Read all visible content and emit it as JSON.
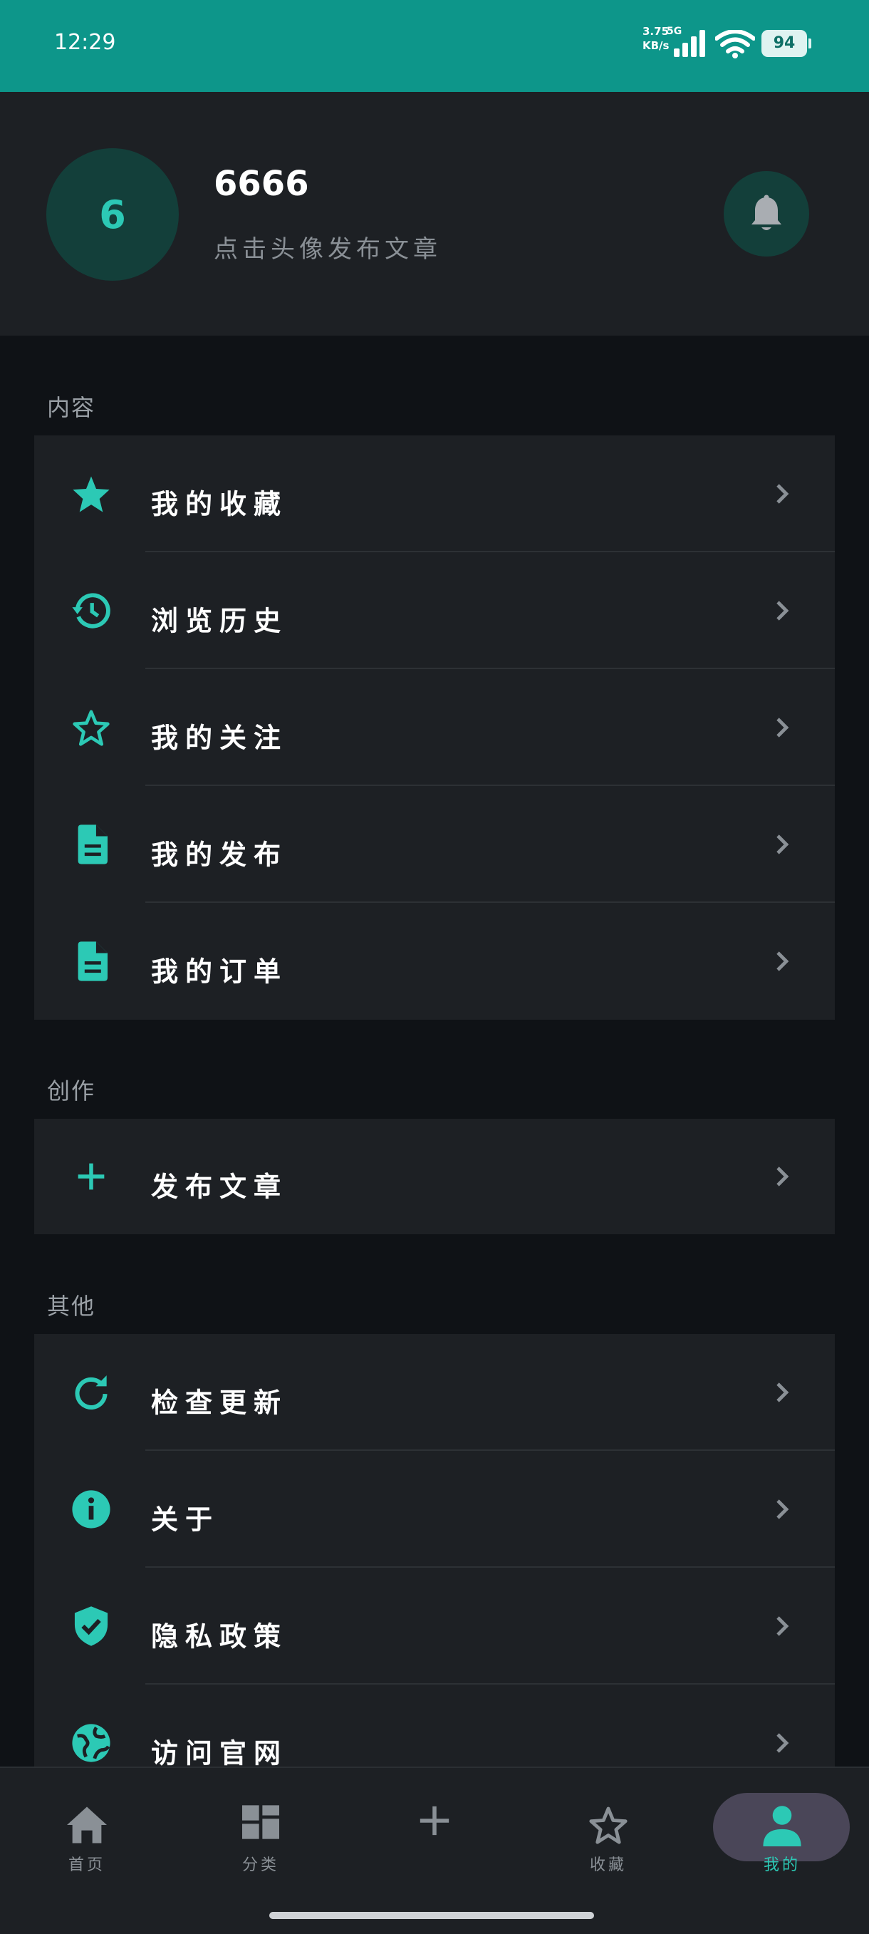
{
  "status_bar": {
    "time": "12:29",
    "net_speed_value": "3.75",
    "net_speed_unit": "KB/s",
    "network_type": "5G",
    "battery": "94"
  },
  "profile": {
    "avatar_text": "6",
    "username": "6666",
    "hint": "点击头像发布文章"
  },
  "sections": {
    "content": {
      "title": "内容",
      "items": [
        {
          "label": "我的收藏",
          "icon": "star-filled-icon"
        },
        {
          "label": "浏览历史",
          "icon": "history-icon"
        },
        {
          "label": "我的关注",
          "icon": "star-outline-icon"
        },
        {
          "label": "我的发布",
          "icon": "document-icon"
        },
        {
          "label": "我的订单",
          "icon": "document-icon"
        }
      ]
    },
    "create": {
      "title": "创作",
      "items": [
        {
          "label": "发布文章",
          "icon": "plus-icon"
        }
      ]
    },
    "other": {
      "title": "其他",
      "items": [
        {
          "label": "检查更新",
          "icon": "refresh-icon"
        },
        {
          "label": "关于",
          "icon": "info-icon"
        },
        {
          "label": "隐私政策",
          "icon": "shield-check-icon"
        },
        {
          "label": "访问官网",
          "icon": "globe-icon"
        }
      ]
    }
  },
  "bottom_nav": {
    "items": [
      {
        "label": "首页",
        "icon": "home-icon"
      },
      {
        "label": "分类",
        "icon": "category-icon"
      },
      {
        "label": "",
        "icon": "plus-icon"
      },
      {
        "label": "收藏",
        "icon": "star-outline-icon"
      },
      {
        "label": "我的",
        "icon": "person-icon",
        "active": true
      }
    ]
  },
  "colors": {
    "accent": "#2cc9b5",
    "status_bar": "#0d968a",
    "card": "#1d2024",
    "background": "#0f1216",
    "active_pill": "#4a4658"
  }
}
